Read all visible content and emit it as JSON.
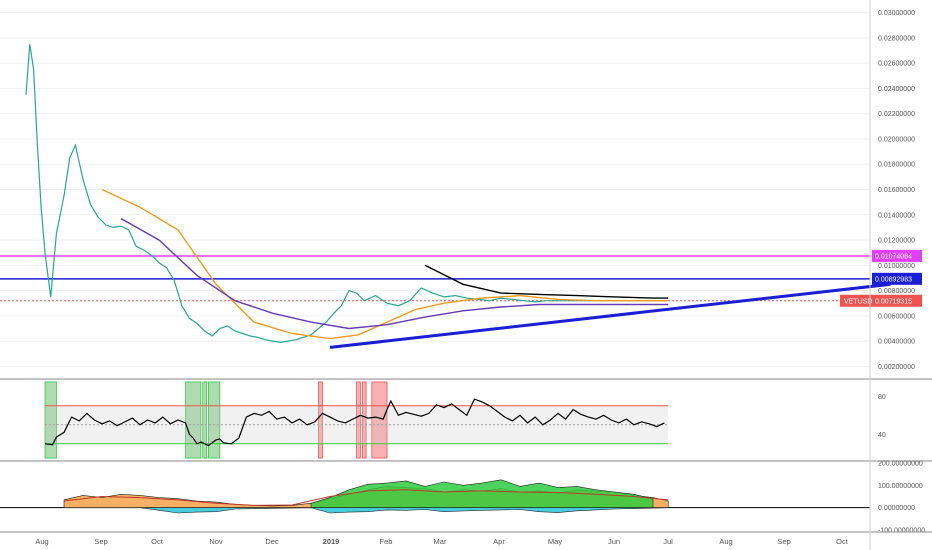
{
  "symbol": "VETUSD",
  "chart_data": [
    {
      "type": "line",
      "panel": "price",
      "y_scale": "linear",
      "ylim": [
        0.001,
        0.031
      ],
      "y_ticks": [
        "0.03000000",
        "0.02800000",
        "0.02600000",
        "0.02400000",
        "0.02200000",
        "0.02000000",
        "0.01800000",
        "0.01600000",
        "0.01400000",
        "0.01200000",
        "0.01000000",
        "0.00800000",
        "0.00600000",
        "0.00400000",
        "0.00200000"
      ],
      "x_ticks": [
        "Aug",
        "Sep",
        "Oct",
        "Nov",
        "Dec",
        "2019",
        "Feb",
        "Mar",
        "Apr",
        "May",
        "Jun",
        "Jul",
        "Aug",
        "Sep",
        "Oct"
      ],
      "series": [
        {
          "name": "close",
          "color": "#26a69a",
          "x": [
            0,
            2,
            4,
            6,
            8,
            10,
            13,
            16,
            20,
            23,
            26,
            30,
            34,
            38,
            42,
            46,
            50,
            54,
            58,
            62,
            66,
            70,
            74,
            78,
            82,
            86,
            90,
            94,
            98,
            102,
            106,
            110,
            114,
            118,
            122,
            126,
            130,
            134,
            138,
            142,
            146,
            150,
            154,
            158,
            162,
            166,
            170,
            174,
            178,
            184,
            190,
            196,
            202,
            208,
            214,
            220,
            226,
            232,
            238,
            244,
            250,
            256,
            262,
            268,
            274,
            280,
            286,
            292,
            298,
            304,
            310,
            316,
            322,
            328,
            334,
            338
          ],
          "y": [
            0.0235,
            0.0275,
            0.0255,
            0.0195,
            0.0145,
            0.011,
            0.0075,
            0.0125,
            0.0155,
            0.0185,
            0.0195,
            0.0168,
            0.0148,
            0.0138,
            0.0132,
            0.013,
            0.0131,
            0.0128,
            0.0115,
            0.0112,
            0.0108,
            0.0102,
            0.0098,
            0.0088,
            0.0068,
            0.0058,
            0.0054,
            0.0048,
            0.0044,
            0.005,
            0.0052,
            0.0048,
            0.0046,
            0.0044,
            0.0043,
            0.0041,
            0.004,
            0.0039,
            0.004,
            0.0041,
            0.0043,
            0.0045,
            0.005,
            0.0055,
            0.0062,
            0.0068,
            0.008,
            0.0078,
            0.0072,
            0.0076,
            0.007,
            0.0068,
            0.0072,
            0.0082,
            0.0078,
            0.0075,
            0.0076,
            0.0074,
            0.0073,
            0.0072,
            0.0074,
            0.0073,
            0.0072,
            0.0071,
            0.0072,
            0.0072,
            0.0072,
            0.0072,
            0.0072,
            0.0072,
            0.0072,
            0.0072,
            0.0072,
            0.0072,
            0.0072,
            0.0072
          ]
        },
        {
          "name": "ma-orange",
          "color": "#f29b1d",
          "x": [
            40,
            60,
            80,
            100,
            120,
            140,
            160,
            175,
            190,
            205,
            220,
            240,
            260,
            280,
            300,
            320,
            338
          ],
          "y": [
            0.016,
            0.0146,
            0.0128,
            0.0085,
            0.0055,
            0.0046,
            0.0042,
            0.0045,
            0.0055,
            0.0065,
            0.007,
            0.0074,
            0.0076,
            0.0073,
            0.0072,
            0.0072,
            0.0072
          ]
        },
        {
          "name": "ma-purple",
          "color": "#673ab7",
          "x": [
            50,
            70,
            90,
            110,
            130,
            150,
            170,
            190,
            210,
            230,
            250,
            270,
            290,
            310,
            325,
            338
          ],
          "y": [
            0.0137,
            0.012,
            0.0092,
            0.0072,
            0.0062,
            0.0055,
            0.005,
            0.0053,
            0.0059,
            0.0064,
            0.0067,
            0.0069,
            0.0069,
            0.0069,
            0.0069,
            0.0069
          ]
        },
        {
          "name": "ma-black",
          "color": "#000000",
          "x": [
            210,
            230,
            250,
            270,
            290,
            310,
            330,
            338
          ],
          "y": [
            0.01,
            0.0085,
            0.0078,
            0.0077,
            0.0076,
            0.0075,
            0.0074,
            0.0074
          ]
        }
      ],
      "hlines": [
        {
          "value": 0.01074084,
          "color": "#e040fb",
          "label": "0.01074084"
        },
        {
          "value": 0.00892983,
          "color": "#1a1fd6",
          "label": "0.00892983"
        },
        {
          "value": 0.00719315,
          "color": "#ef5350",
          "label": "0.00719315",
          "dotted": true
        }
      ],
      "trendline": {
        "color": "#1a1fd6",
        "from": [
          160,
          0.0035
        ],
        "to": [
          455,
          0.0085
        ]
      },
      "last_label": {
        "symbol": "VETUSD",
        "value": "0.00719315",
        "color": "#ef5350"
      }
    },
    {
      "type": "line",
      "panel": "rsi",
      "ylim": [
        15,
        95
      ],
      "y_ticks": [
        "80",
        "40"
      ],
      "levels": [
        {
          "value": 70,
          "color": "#ef5350"
        },
        {
          "value": 30,
          "color": "#2ecc40"
        },
        {
          "value": 50,
          "color": "#9e9e9e"
        }
      ],
      "series": [
        {
          "name": "rsi",
          "color": "#000000",
          "x": [
            10,
            14,
            16,
            20,
            24,
            28,
            32,
            36,
            40,
            44,
            48,
            52,
            56,
            60,
            64,
            68,
            72,
            76,
            80,
            84,
            86,
            88,
            90,
            92,
            96,
            100,
            102,
            104,
            108,
            112,
            116,
            120,
            124,
            128,
            132,
            136,
            140,
            144,
            148,
            152,
            156,
            160,
            164,
            168,
            172,
            176,
            180,
            184,
            188,
            190,
            192,
            196,
            200,
            204,
            208,
            212,
            216,
            220,
            224,
            228,
            232,
            236,
            240,
            244,
            248,
            252,
            256,
            260,
            264,
            268,
            272,
            276,
            280,
            284,
            288,
            292,
            296,
            300,
            304,
            308,
            312,
            316,
            320,
            324,
            328,
            332,
            336
          ],
          "y": [
            30,
            29,
            37,
            42,
            58,
            54,
            62,
            55,
            51,
            54,
            49,
            53,
            57,
            50,
            55,
            52,
            58,
            51,
            55,
            52,
            40,
            36,
            30,
            32,
            28,
            34,
            35,
            31,
            30,
            36,
            58,
            62,
            60,
            64,
            56,
            58,
            52,
            56,
            50,
            53,
            62,
            58,
            54,
            52,
            56,
            60,
            57,
            58,
            56,
            66,
            75,
            60,
            63,
            61,
            59,
            62,
            71,
            68,
            72,
            66,
            60,
            77,
            74,
            70,
            64,
            58,
            54,
            60,
            52,
            58,
            50,
            55,
            62,
            56,
            66,
            61,
            58,
            56,
            60,
            55,
            52,
            56,
            50,
            53,
            51,
            48,
            52
          ]
        }
      ],
      "zones": [
        {
          "from": 10,
          "to": 16,
          "color": "green"
        },
        {
          "from": 84,
          "to": 92,
          "color": "green"
        },
        {
          "from": 93,
          "to": 95,
          "color": "green"
        },
        {
          "from": 96,
          "to": 102,
          "color": "green"
        },
        {
          "from": 154,
          "to": 156,
          "color": "red"
        },
        {
          "from": 174,
          "to": 176,
          "color": "red"
        },
        {
          "from": 177,
          "to": 179,
          "color": "red"
        },
        {
          "from": 182,
          "to": 190,
          "color": "red"
        }
      ]
    },
    {
      "type": "area",
      "panel": "oscillator",
      "ylim": [
        -100,
        200
      ],
      "y_ticks": [
        "200.00000000",
        "100.00000000",
        "0.00000000",
        "-100.00000000"
      ],
      "series": [
        {
          "name": "orange-area",
          "color": "#f7a24a",
          "x": [
            20,
            30,
            40,
            50,
            60,
            70,
            80,
            90,
            100,
            110,
            120,
            130,
            140,
            150,
            160,
            170,
            180,
            190,
            200,
            210,
            220,
            230,
            240,
            250,
            260,
            270,
            280,
            290,
            300,
            310,
            320,
            330,
            338
          ],
          "y": [
            35,
            55,
            45,
            60,
            55,
            45,
            40,
            30,
            25,
            15,
            10,
            8,
            10,
            20,
            40,
            60,
            80,
            95,
            90,
            85,
            70,
            80,
            75,
            85,
            70,
            75,
            65,
            80,
            75,
            70,
            55,
            45,
            30
          ]
        },
        {
          "name": "green-area",
          "color": "#2ecc40",
          "x": [
            150,
            160,
            170,
            180,
            190,
            200,
            210,
            220,
            230,
            240,
            250,
            260,
            270,
            280,
            290,
            300,
            310,
            320,
            330
          ],
          "y": [
            20,
            45,
            80,
            105,
            110,
            120,
            95,
            115,
            100,
            110,
            125,
            95,
            110,
            90,
            95,
            80,
            70,
            60,
            40
          ]
        },
        {
          "name": "cyan-area",
          "color": "#26c6da",
          "x": [
            60,
            70,
            80,
            90,
            100,
            110,
            150,
            160,
            170,
            180,
            190,
            200,
            210,
            220,
            230,
            240,
            250,
            260,
            270,
            280,
            290,
            300,
            310,
            320,
            330,
            338
          ],
          "y": [
            0,
            -12,
            -24,
            -20,
            -18,
            -6,
            0,
            -24,
            -20,
            -18,
            -10,
            -12,
            -8,
            -18,
            -15,
            -12,
            -10,
            -8,
            -18,
            -22,
            -14,
            -10,
            -6,
            -4,
            -2,
            0
          ]
        },
        {
          "name": "red-line",
          "color": "#c0392b",
          "x": [
            20,
            40,
            60,
            80,
            100,
            120,
            140,
            160,
            180,
            200,
            220,
            240,
            260,
            280,
            300,
            320,
            338
          ],
          "y": [
            30,
            50,
            45,
            35,
            20,
            10,
            12,
            50,
            75,
            80,
            70,
            75,
            70,
            68,
            60,
            50,
            35
          ]
        }
      ]
    }
  ]
}
